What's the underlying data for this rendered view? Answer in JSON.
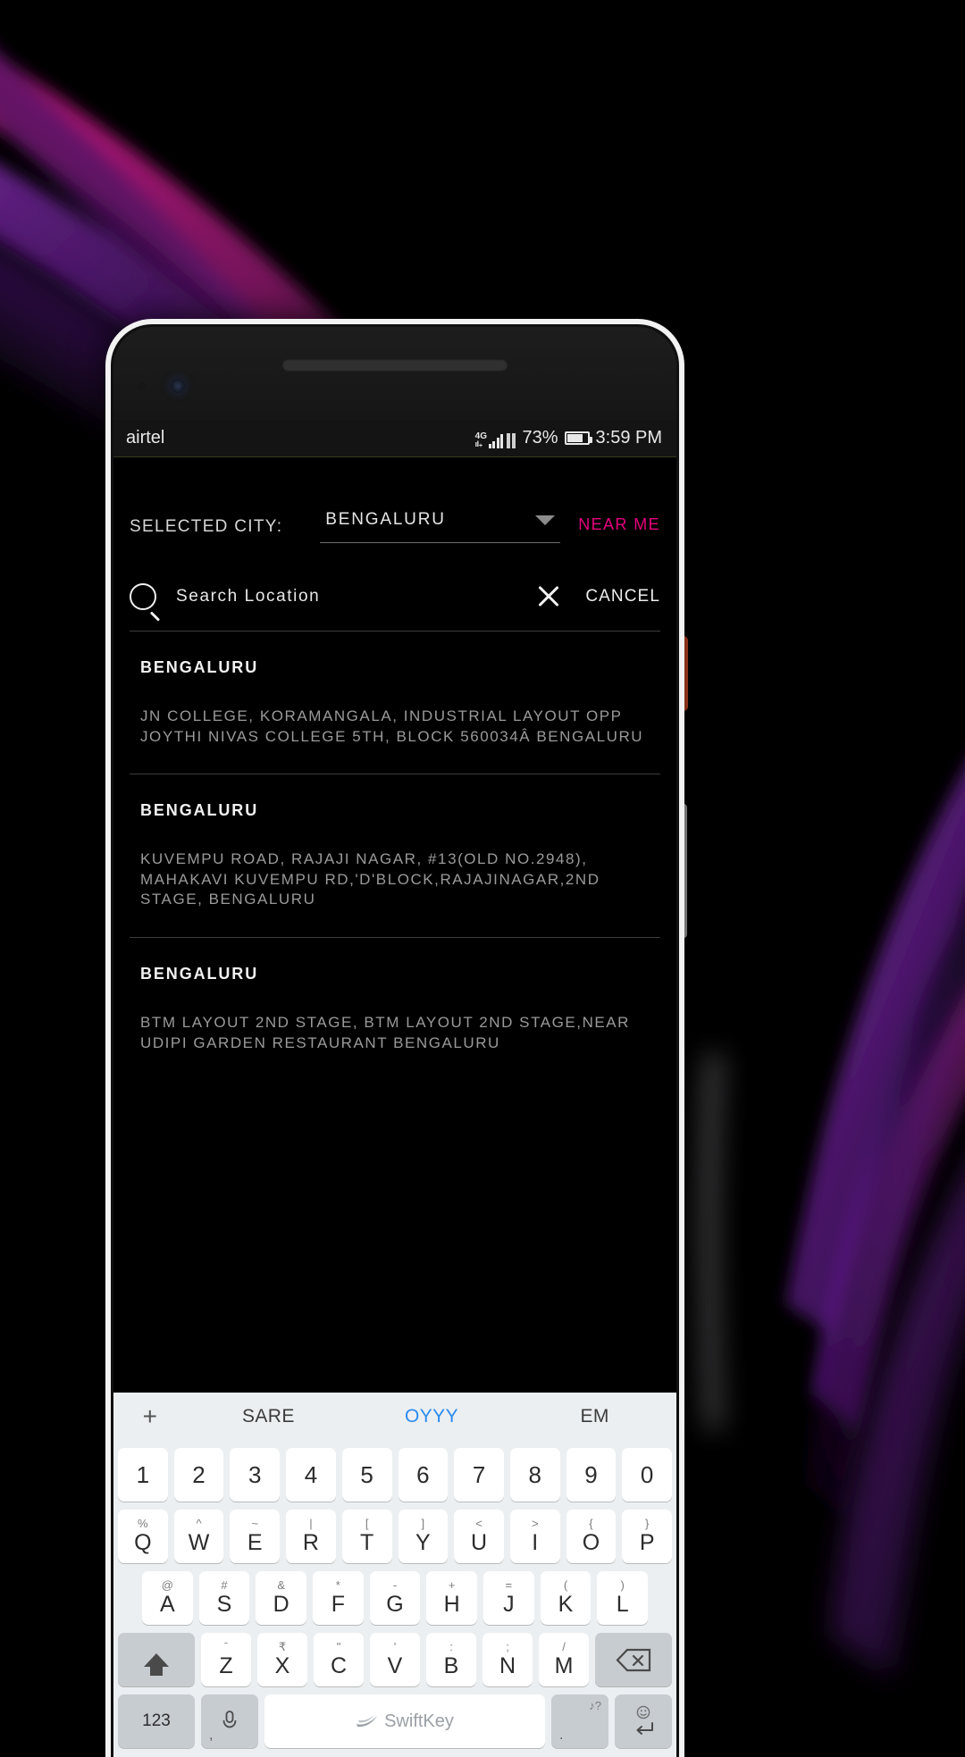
{
  "statusbar": {
    "carrier": "airtel",
    "network": "4G",
    "battery_percent": "73%",
    "time": "3:59 PM"
  },
  "app": {
    "city_label": "SELECTED CITY:",
    "city_value": "BENGALURU",
    "near_me_label": "NEAR ME",
    "near_me_color": "#e6007e",
    "search_placeholder": "Search Location",
    "search_value": "",
    "cancel_label": "CANCEL",
    "results": [
      {
        "title": "BENGALURU",
        "address": "JN COLLEGE, KORAMANGALA, INDUSTRIAL LAYOUT OPP JOYTHI NIVAS COLLEGE 5TH, BLOCK 560034Â BENGALURU"
      },
      {
        "title": "BENGALURU",
        "address": "KUVEMPU ROAD, RAJAJI NAGAR, #13(OLD NO.2948), MAHAKAVI KUVEMPU RD,'D'BLOCK,RAJAJINAGAR,2ND STAGE, BENGALURU"
      },
      {
        "title": "BENGALURU",
        "address": "BTM LAYOUT 2ND STAGE, BTM LAYOUT 2ND STAGE,NEAR UDIPI GARDEN RESTAURANT BENGALURU"
      }
    ]
  },
  "keyboard": {
    "suggestions": [
      {
        "label": "+",
        "active": false
      },
      {
        "label": "SARE",
        "active": false
      },
      {
        "label": "OYYY",
        "active": true
      },
      {
        "label": "EM",
        "active": false
      }
    ],
    "active_suggestion_color": "#2a8cf0",
    "row_numbers": [
      {
        "main": "1",
        "sub": ""
      },
      {
        "main": "2",
        "sub": ""
      },
      {
        "main": "3",
        "sub": ""
      },
      {
        "main": "4",
        "sub": ""
      },
      {
        "main": "5",
        "sub": ""
      },
      {
        "main": "6",
        "sub": ""
      },
      {
        "main": "7",
        "sub": ""
      },
      {
        "main": "8",
        "sub": ""
      },
      {
        "main": "9",
        "sub": ""
      },
      {
        "main": "0",
        "sub": ""
      }
    ],
    "row_q": [
      {
        "main": "Q",
        "sub": "%"
      },
      {
        "main": "W",
        "sub": "^"
      },
      {
        "main": "E",
        "sub": "~"
      },
      {
        "main": "R",
        "sub": "|"
      },
      {
        "main": "T",
        "sub": "["
      },
      {
        "main": "Y",
        "sub": "]"
      },
      {
        "main": "U",
        "sub": "<"
      },
      {
        "main": "I",
        "sub": ">"
      },
      {
        "main": "O",
        "sub": "{"
      },
      {
        "main": "P",
        "sub": "}"
      }
    ],
    "row_a": [
      {
        "main": "A",
        "sub": "@"
      },
      {
        "main": "S",
        "sub": "#"
      },
      {
        "main": "D",
        "sub": "&"
      },
      {
        "main": "F",
        "sub": "*"
      },
      {
        "main": "G",
        "sub": "-"
      },
      {
        "main": "H",
        "sub": "+"
      },
      {
        "main": "J",
        "sub": "="
      },
      {
        "main": "K",
        "sub": "("
      },
      {
        "main": "L",
        "sub": ")"
      }
    ],
    "row_z": [
      {
        "main": "Z",
        "sub": "̄"
      },
      {
        "main": "X",
        "sub": "₹"
      },
      {
        "main": "C",
        "sub": "\""
      },
      {
        "main": "V",
        "sub": "'"
      },
      {
        "main": "B",
        "sub": ":"
      },
      {
        "main": "N",
        "sub": ";"
      },
      {
        "main": "M",
        "sub": "/"
      }
    ],
    "numeric_key": "123",
    "comma_key": ",",
    "period_key": ".",
    "period_sub": "♪?",
    "brand": "SwiftKey"
  }
}
